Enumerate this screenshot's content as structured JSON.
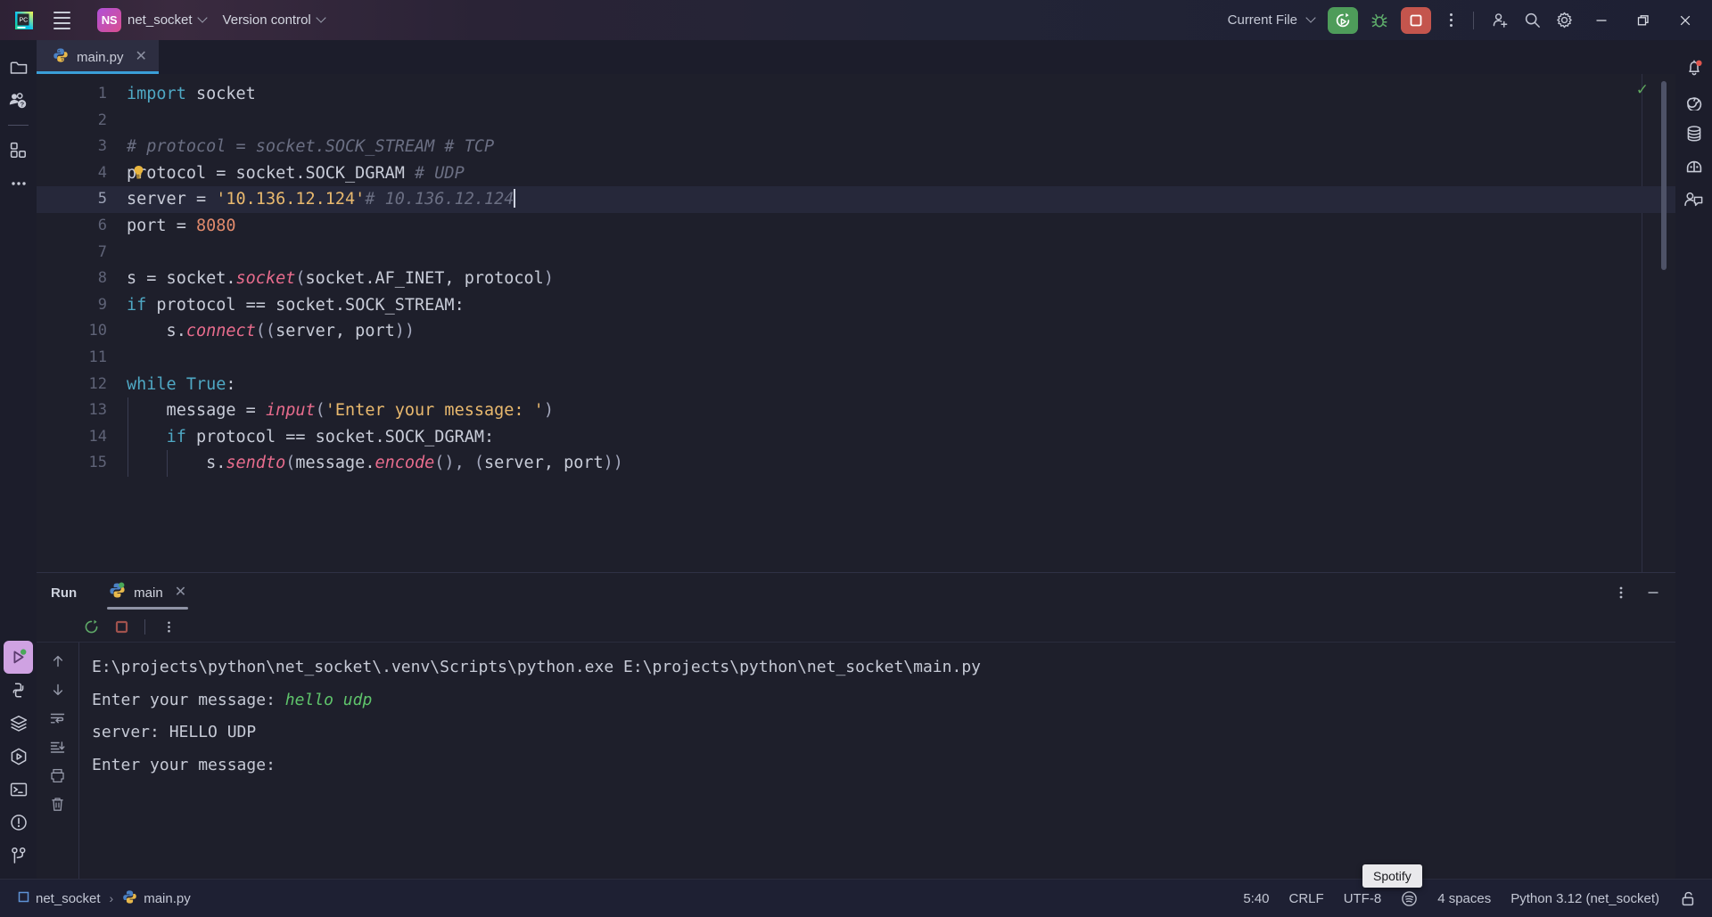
{
  "titlebar": {
    "app_icon": "pycharm-logo-icon",
    "menu_icon": "hamburger-menu-icon",
    "project_initials": "NS",
    "project_name": "net_socket",
    "version_control": "Version control",
    "run_config": "Current File",
    "run_icon": "run-rerun-icon",
    "debug_icon": "debug-bug-icon",
    "stop_icon": "stop-square-icon",
    "more_icon": "more-vertical-icon",
    "account_icon": "add-account-icon",
    "search_icon": "search-icon",
    "settings_icon": "gear-icon",
    "minimize_icon": "minimize-icon",
    "maximize_icon": "restore-window-icon",
    "close_icon": "close-icon"
  },
  "left_stripe": {
    "top": [
      {
        "name": "project-tool-icon",
        "label": "Project"
      },
      {
        "name": "learn-help-icon",
        "label": "Learn"
      },
      {
        "name": "plugins-icon",
        "label": "Plugins"
      },
      {
        "name": "more-tools-icon",
        "label": "More tool windows"
      }
    ],
    "bottom": [
      {
        "name": "run-tool-icon",
        "label": "Run",
        "active": true
      },
      {
        "name": "python-console-icon",
        "label": "Python Console"
      },
      {
        "name": "database-layers-icon",
        "label": "Services"
      },
      {
        "name": "run-anything-icon",
        "label": "Run Anything"
      },
      {
        "name": "terminal-icon",
        "label": "Terminal"
      },
      {
        "name": "problems-icon",
        "label": "Problems"
      },
      {
        "name": "version-control-branch-icon",
        "label": "Version Control"
      }
    ]
  },
  "right_stripe": {
    "items": [
      {
        "name": "notifications-bell-icon",
        "label": "Notifications",
        "badge": true
      },
      {
        "name": "ai-assistant-icon",
        "label": "AI Assistant"
      },
      {
        "name": "database-icon",
        "label": "Database"
      },
      {
        "name": "packages-icon",
        "label": "Python Packages"
      },
      {
        "name": "collaboration-icon",
        "label": "Code With Me"
      }
    ]
  },
  "tabs": [
    {
      "label": "main.py",
      "icon": "python-file-icon",
      "active": true,
      "close_icon": "close-tab-icon"
    }
  ],
  "editor": {
    "status_icon": "inspection-ok-checkmark-icon",
    "bulb_icon": "intention-bulb-icon",
    "caret_line": 5,
    "lines": [
      {
        "n": 1,
        "tokens": [
          {
            "t": "import",
            "c": "kw"
          },
          {
            "t": " socket",
            "c": "txt"
          }
        ]
      },
      {
        "n": 2,
        "tokens": []
      },
      {
        "n": 3,
        "tokens": [
          {
            "t": "# protocol = socket.SOCK_STREAM # TCP",
            "c": "cmt"
          }
        ]
      },
      {
        "n": 4,
        "tokens": [
          {
            "t": "protocol ",
            "c": "txt"
          },
          {
            "t": "=",
            "c": "op"
          },
          {
            "t": " socket.SOCK_DGRAM ",
            "c": "txt"
          },
          {
            "t": "# UDP",
            "c": "cmt"
          }
        ]
      },
      {
        "n": 5,
        "tokens": [
          {
            "t": "server ",
            "c": "txt"
          },
          {
            "t": "=",
            "c": "op"
          },
          {
            "t": " ",
            "c": "txt"
          },
          {
            "t": "'10.136.12.124'",
            "c": "str"
          },
          {
            "t": "# 10.136.12.124",
            "c": "cmt"
          }
        ]
      },
      {
        "n": 6,
        "tokens": [
          {
            "t": "port ",
            "c": "txt"
          },
          {
            "t": "=",
            "c": "op"
          },
          {
            "t": " ",
            "c": "txt"
          },
          {
            "t": "8080",
            "c": "num"
          }
        ]
      },
      {
        "n": 7,
        "tokens": []
      },
      {
        "n": 8,
        "tokens": [
          {
            "t": "s ",
            "c": "txt"
          },
          {
            "t": "=",
            "c": "op"
          },
          {
            "t": " socket.",
            "c": "txt"
          },
          {
            "t": "socket",
            "c": "fn"
          },
          {
            "t": "(",
            "c": "paren"
          },
          {
            "t": "socket.AF_INET, protocol",
            "c": "txt"
          },
          {
            "t": ")",
            "c": "paren"
          }
        ]
      },
      {
        "n": 9,
        "tokens": [
          {
            "t": "if",
            "c": "kw"
          },
          {
            "t": " protocol ",
            "c": "txt"
          },
          {
            "t": "==",
            "c": "op"
          },
          {
            "t": " socket.SOCK_STREAM",
            "c": "txt"
          },
          {
            "t": ":",
            "c": "op"
          }
        ]
      },
      {
        "n": 10,
        "tokens": [
          {
            "t": "    s.",
            "c": "txt"
          },
          {
            "t": "connect",
            "c": "fn"
          },
          {
            "t": "((",
            "c": "paren"
          },
          {
            "t": "server, port",
            "c": "txt"
          },
          {
            "t": "))",
            "c": "paren"
          }
        ]
      },
      {
        "n": 11,
        "tokens": []
      },
      {
        "n": 12,
        "tokens": [
          {
            "t": "while",
            "c": "kw"
          },
          {
            "t": " ",
            "c": "txt"
          },
          {
            "t": "True",
            "c": "kw"
          },
          {
            "t": ":",
            "c": "op"
          }
        ]
      },
      {
        "n": 13,
        "tokens": [
          {
            "t": "    message ",
            "c": "txt"
          },
          {
            "t": "=",
            "c": "op"
          },
          {
            "t": " ",
            "c": "txt"
          },
          {
            "t": "input",
            "c": "fn"
          },
          {
            "t": "(",
            "c": "paren"
          },
          {
            "t": "'Enter your message: '",
            "c": "str"
          },
          {
            "t": ")",
            "c": "paren"
          }
        ]
      },
      {
        "n": 14,
        "tokens": [
          {
            "t": "    ",
            "c": "txt"
          },
          {
            "t": "if",
            "c": "kw"
          },
          {
            "t": " protocol ",
            "c": "txt"
          },
          {
            "t": "==",
            "c": "op"
          },
          {
            "t": " socket.SOCK_DGRAM",
            "c": "txt"
          },
          {
            "t": ":",
            "c": "op"
          }
        ]
      },
      {
        "n": 15,
        "tokens": [
          {
            "t": "        s.",
            "c": "txt"
          },
          {
            "t": "sendto",
            "c": "fn"
          },
          {
            "t": "(",
            "c": "paren"
          },
          {
            "t": "message.",
            "c": "txt"
          },
          {
            "t": "encode",
            "c": "fn"
          },
          {
            "t": "(), (",
            "c": "paren"
          },
          {
            "t": "server, port",
            "c": "txt"
          },
          {
            "t": "))",
            "c": "paren"
          }
        ]
      }
    ]
  },
  "run_panel": {
    "title": "Run",
    "tab_label": "main",
    "tab_icon": "python-run-icon",
    "tab_close_icon": "close-tab-icon",
    "options_icon": "more-vertical-icon",
    "minimize_icon": "minimize-panel-icon",
    "toolbar": [
      {
        "name": "rerun-icon",
        "label": "Rerun"
      },
      {
        "name": "stop-icon",
        "label": "Stop"
      },
      {
        "name": "more-vertical-icon",
        "label": "More"
      }
    ],
    "gutter": [
      {
        "name": "up-arrow-icon",
        "label": "Previous occurrence"
      },
      {
        "name": "down-arrow-icon",
        "label": "Next occurrence"
      },
      {
        "name": "soft-wrap-icon",
        "label": "Soft-Wrap"
      },
      {
        "name": "scroll-to-end-icon",
        "label": "Scroll to end"
      },
      {
        "name": "print-icon",
        "label": "Print"
      },
      {
        "name": "trash-icon",
        "label": "Clear All"
      }
    ],
    "console": [
      {
        "text": "E:\\projects\\python\\net_socket\\.venv\\Scripts\\python.exe E:\\projects\\python\\net_socket\\main.py",
        "kind": "plain"
      },
      {
        "prompt": "Enter your message: ",
        "input": "hello udp",
        "kind": "prompt"
      },
      {
        "text": "server: HELLO UDP",
        "kind": "plain"
      },
      {
        "text": "Enter your message: ",
        "kind": "plain"
      }
    ]
  },
  "statusbar": {
    "breadcrumb": [
      {
        "label": "net_socket",
        "icon": "module-icon"
      },
      {
        "label": "main.py",
        "icon": "python-file-icon"
      }
    ],
    "separator": "›",
    "caret_position": "5:40",
    "line_separator": "CRLF",
    "encoding": "UTF-8",
    "indent": "4 spaces",
    "interpreter": "Python 3.12 (net_socket)",
    "lock_icon": "unlocked-padlock-icon",
    "tooltip": "Spotify"
  },
  "colors": {
    "accent_blue": "#3a9fd8",
    "run_green": "#4e9c5a",
    "stop_red": "#c4554d",
    "string": "#e9b96e",
    "keyword": "#4fa8c4",
    "comment": "#6b6f83",
    "function": "#e86c8d",
    "number": "#e08a6c",
    "console_input": "#5fc46b"
  }
}
